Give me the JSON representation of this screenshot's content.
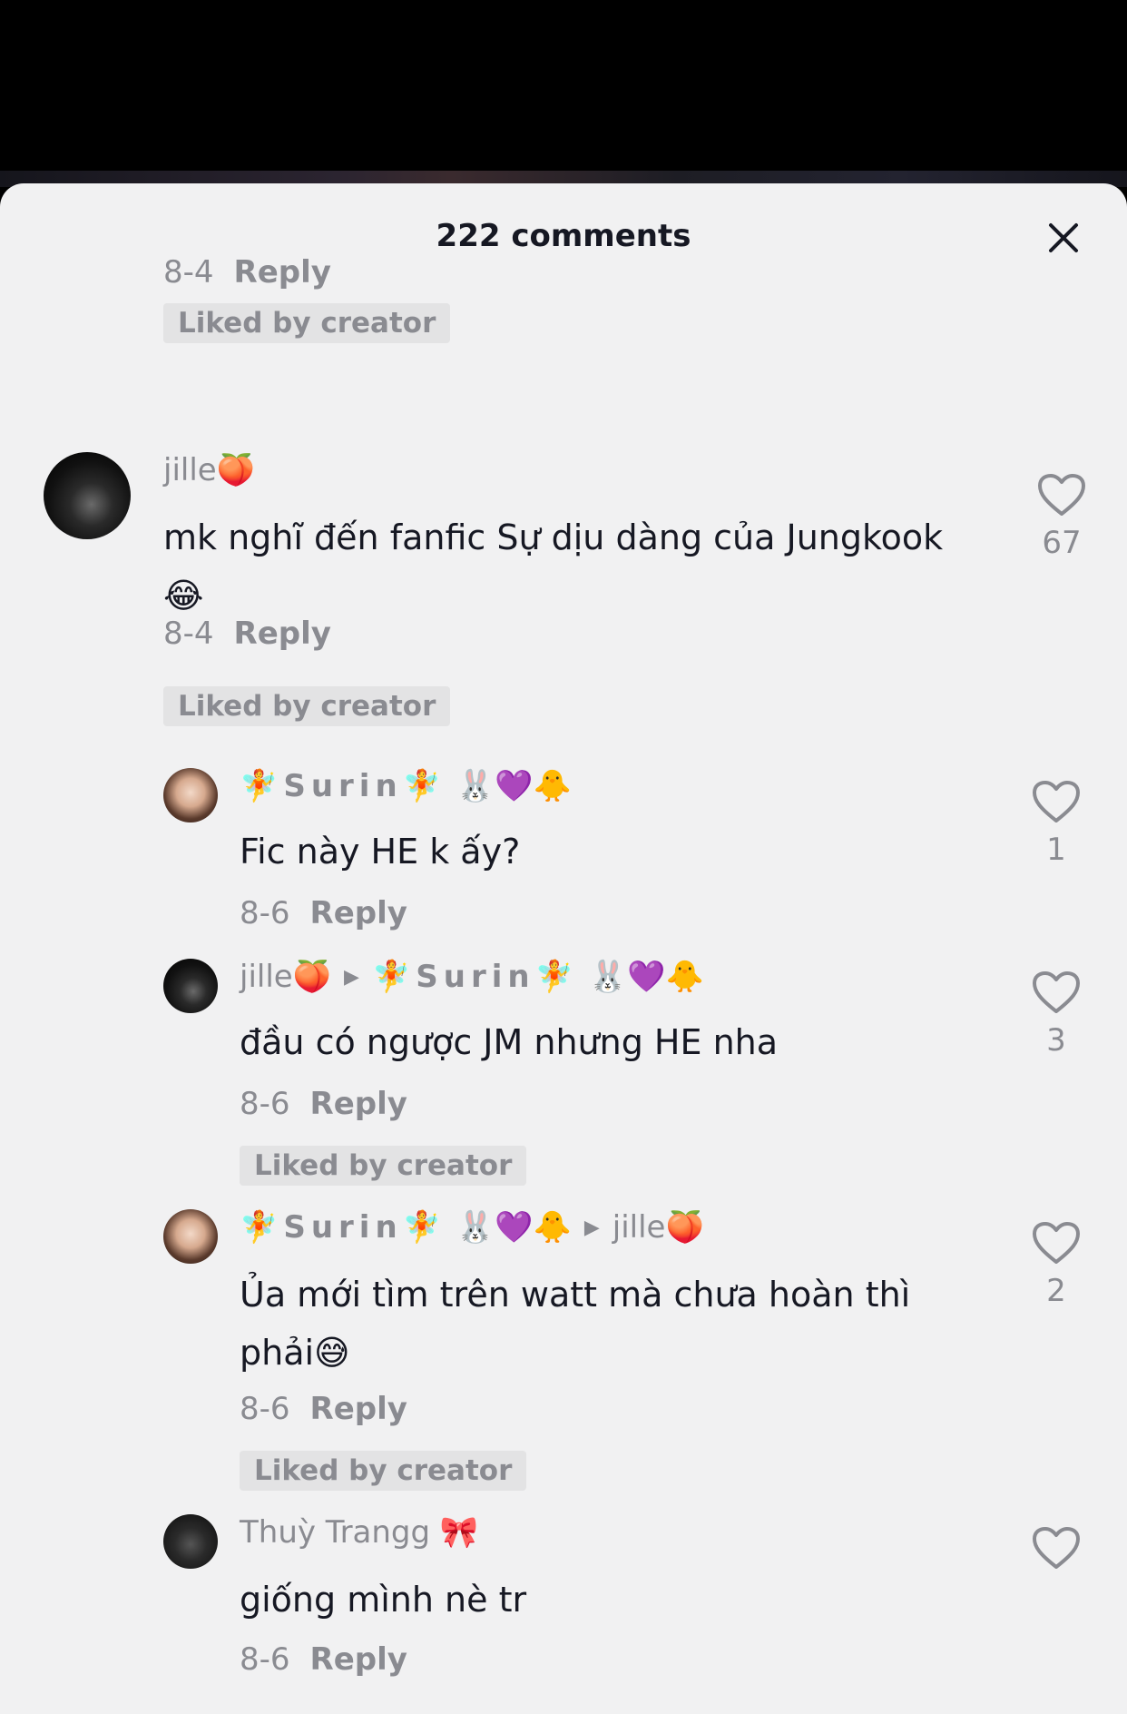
{
  "header": {
    "title": "222 comments"
  },
  "prev_comment": {
    "date": "8-4",
    "reply_label": "Reply",
    "liked_label": "Liked by creator"
  },
  "comments": [
    {
      "username": "jille🍑",
      "text": "mk nghĩ đến fanfic Sự dịu dàng của Jungkook",
      "text_emoji": "😂",
      "date": "8-4",
      "reply_label": "Reply",
      "liked_label": "Liked by creator",
      "likes": "67"
    },
    {
      "username": "🧚Surin🧚",
      "username_suffix": "🐰💜🐥",
      "text": "Fic này HE k ấy?",
      "date": "8-6",
      "reply_label": "Reply",
      "likes": "1"
    },
    {
      "username": "jille🍑",
      "reply_to": "🧚Surin🧚",
      "reply_to_suffix": "🐰💜🐥",
      "text": "đầu có ngược JM nhưng HE nha",
      "date": "8-6",
      "reply_label": "Reply",
      "liked_label": "Liked by creator",
      "likes": "3"
    },
    {
      "username": "🧚Surin🧚",
      "username_suffix": "🐰💜🐥",
      "reply_to": "jille🍑",
      "text": "Ủa mới tìm trên watt mà chưa hoàn thì",
      "text_line2": "phải😅",
      "date": "8-6",
      "reply_label": "Reply",
      "liked_label": "Liked by creator",
      "likes": "2"
    },
    {
      "username": "Thuỳ Trangg",
      "username_suffix": "🎀",
      "text": "giống mình nè tr",
      "date": "8-6",
      "reply_label": "Reply"
    }
  ],
  "icons": {
    "close": "close-icon",
    "heart": "heart-icon",
    "reply_arrow": "triangle-right-icon"
  }
}
